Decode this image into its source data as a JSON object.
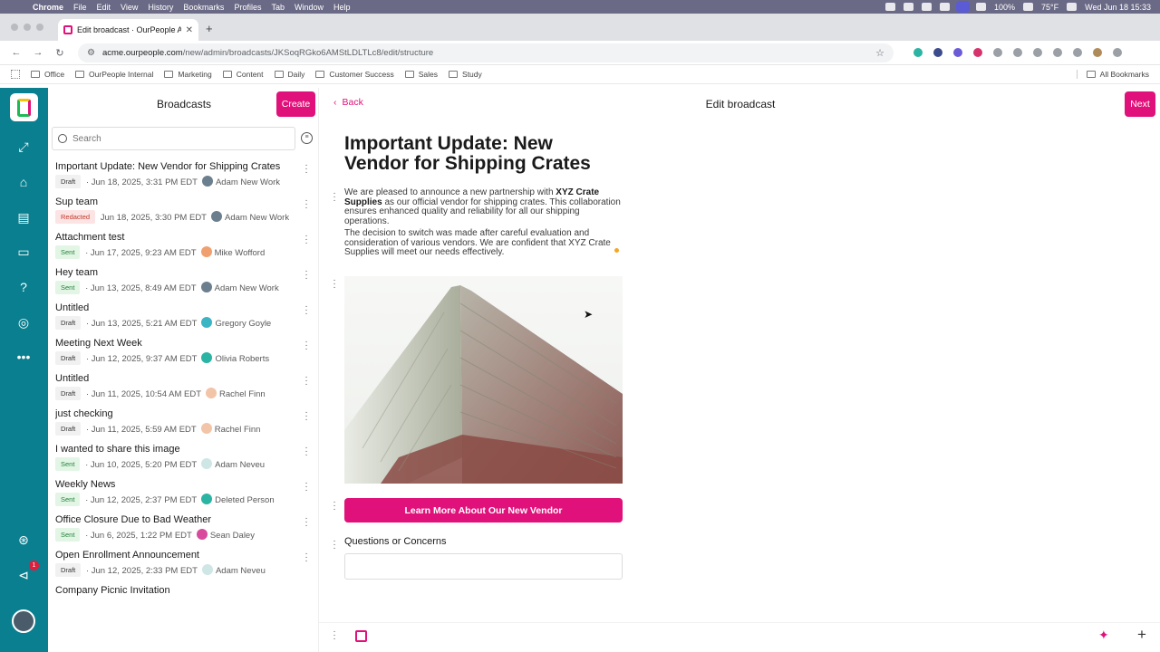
{
  "menubar": {
    "app": "Chrome",
    "items": [
      "File",
      "Edit",
      "View",
      "History",
      "Bookmarks",
      "Profiles",
      "Tab",
      "Window",
      "Help"
    ],
    "battery": "100%",
    "weather": "75°F",
    "datetime": "Wed Jun 18  15:33"
  },
  "browser": {
    "tab_title": "Edit broadcast · OurPeople Ad",
    "url_domain": "acme.ourpeople.com",
    "url_path": "/new/admin/broadcasts/JKSoqRGko6AMStLDLTLc8/edit/structure",
    "bookmarks": [
      "Office",
      "OurPeople Internal",
      "Marketing",
      "Content",
      "Daily",
      "Customer Success",
      "Sales",
      "Study"
    ],
    "all_bookmarks": "All Bookmarks"
  },
  "sidebar": {
    "notification_count": "1"
  },
  "list": {
    "title": "Broadcasts",
    "create_label": "Create",
    "search_placeholder": "Search",
    "items": [
      {
        "title": "Important Update: New Vendor for Shipping Crates",
        "status": "Draft",
        "date": "Jun 18, 2025, 3:31 PM EDT",
        "author": "Adam New Work"
      },
      {
        "title": "Sup team",
        "status": "Redacted",
        "date": "Jun 18, 2025, 3:30 PM EDT",
        "author": "Adam New Work"
      },
      {
        "title": "Attachment test",
        "status": "Sent",
        "date": "Jun 17, 2025, 9:23 AM EDT",
        "author": "Mike Wofford"
      },
      {
        "title": "Hey team",
        "status": "Sent",
        "date": "Jun 13, 2025, 8:49 AM EDT",
        "author": "Adam New Work"
      },
      {
        "title": "Untitled",
        "status": "Draft",
        "date": "Jun 13, 2025, 5:21 AM EDT",
        "author": "Gregory Goyle"
      },
      {
        "title": "Meeting Next Week",
        "status": "Draft",
        "date": "Jun 12, 2025, 9:37 AM EDT",
        "author": "Olivia Roberts"
      },
      {
        "title": "Untitled",
        "status": "Draft",
        "date": "Jun 11, 2025, 10:54 AM EDT",
        "author": "Rachel Finn"
      },
      {
        "title": "just checking",
        "status": "Draft",
        "date": "Jun 11, 2025, 5:59 AM EDT",
        "author": "Rachel Finn"
      },
      {
        "title": "I wanted to share this image",
        "status": "Sent",
        "date": "Jun 10, 2025, 5:20 PM EDT",
        "author": "Adam Neveu"
      },
      {
        "title": "Weekly News",
        "status": "Sent",
        "date": "Jun 12, 2025, 2:37 PM EDT",
        "author": "Deleted Person"
      },
      {
        "title": "Office Closure Due to Bad Weather",
        "status": "Sent",
        "date": "Jun 6, 2025, 1:22 PM EDT",
        "author": "Sean Daley"
      },
      {
        "title": "Open Enrollment Announcement",
        "status": "Draft",
        "date": "Jun 12, 2025, 2:33 PM EDT",
        "author": "Adam Neveu"
      },
      {
        "title": "Company Picnic Invitation",
        "status": "",
        "date": "",
        "author": ""
      }
    ]
  },
  "editor": {
    "back_label": "Back",
    "title": "Edit broadcast",
    "next_label": "Next",
    "headline": "Important Update: New Vendor for Shipping Crates",
    "para1_before": "We are pleased to announce a new partnership with ",
    "para1_bold": "XYZ Crate Supplies",
    "para1_after": " as our official vendor for shipping crates. This collaboration ensures enhanced quality and reliability for all our shipping operations.",
    "para2": "The decision to switch was made after careful evaluation and consideration of various vendors. We are confident that XYZ Crate Supplies will meet our needs effectively.",
    "cta_label": "Learn More About Our New Vendor",
    "question_label": "Questions or Concerns"
  },
  "colors": {
    "brand": "#e0117a",
    "rail": "#0a7f8f"
  }
}
